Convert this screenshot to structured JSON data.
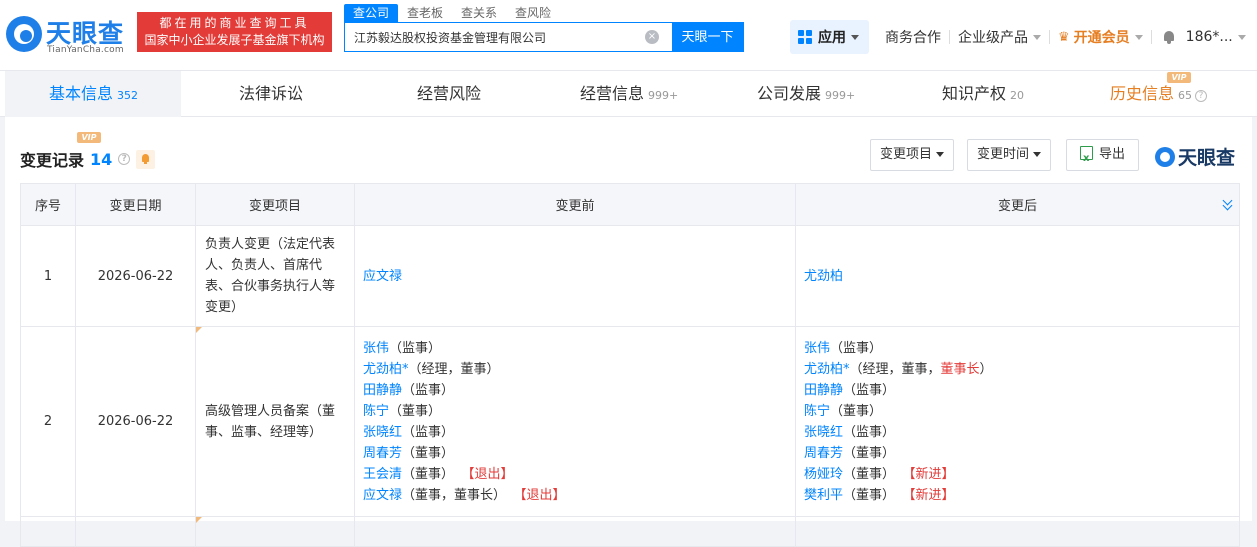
{
  "logo": {
    "cn": "天眼查",
    "en": "TianYanCha.com"
  },
  "slogan": {
    "line1": "都在用的商业查询工具",
    "line2": "国家中小企业发展子基金旗下机构"
  },
  "search": {
    "tabs": [
      "查公司",
      "查老板",
      "查关系",
      "查风险"
    ],
    "value": "江苏毅达股权投资基金管理有限公司",
    "button": "天眼一下"
  },
  "nav": {
    "apps": "应用",
    "business": "商务合作",
    "enterprise": "企业级产品",
    "vip": "开通会员",
    "user": "186*..."
  },
  "tabs": [
    {
      "label": "基本信息",
      "count": "352"
    },
    {
      "label": "法律诉讼",
      "count": ""
    },
    {
      "label": "经营风险",
      "count": ""
    },
    {
      "label": "经营信息",
      "count": "999+"
    },
    {
      "label": "公司发展",
      "count": "999+"
    },
    {
      "label": "知识产权",
      "count": "20"
    },
    {
      "label": "历史信息",
      "count": "65"
    }
  ],
  "vip_badge": "VIP",
  "section": {
    "title": "变更记录",
    "count": "14",
    "filter_item": "变更项目",
    "filter_time": "变更时间",
    "export": "导出",
    "brand": "天眼查"
  },
  "table": {
    "headers": [
      "序号",
      "变更日期",
      "变更项目",
      "变更前",
      "变更后"
    ],
    "rows": [
      {
        "index": "1",
        "date": "2026-06-22",
        "item": "负责人变更（法定代表人、负责人、首席代表、合伙事务执行人等变更）",
        "before": [
          {
            "name": "应文禄",
            "role": "",
            "tag": ""
          }
        ],
        "after": [
          {
            "name": "尤劲柏",
            "role": "",
            "tag": ""
          }
        ]
      },
      {
        "index": "2",
        "date": "2026-06-22",
        "item": "高级管理人员备案（董事、监事、经理等）",
        "before": [
          {
            "name": "张伟",
            "role": "（监事）",
            "tag": ""
          },
          {
            "name": "尤劲柏*",
            "role": "（经理，董事）",
            "tag": ""
          },
          {
            "name": "田静静",
            "role": "（监事）",
            "tag": ""
          },
          {
            "name": "陈宁",
            "role": "（董事）",
            "tag": ""
          },
          {
            "name": "张晓红",
            "role": "（监事）",
            "tag": ""
          },
          {
            "name": "周春芳",
            "role": "（董事）",
            "tag": ""
          },
          {
            "name": "王会清",
            "role": "（董事）",
            "tag": "【退出】"
          },
          {
            "name": "应文禄",
            "role": "（董事，董事长）",
            "tag": "【退出】"
          }
        ],
        "after": [
          {
            "name": "张伟",
            "role": "（监事）",
            "tag": ""
          },
          {
            "name": "尤劲柏*",
            "role": "（经理，董事，",
            "role_red": "董事长",
            "role_end": "）",
            "tag": ""
          },
          {
            "name": "田静静",
            "role": "（监事）",
            "tag": ""
          },
          {
            "name": "陈宁",
            "role": "（董事）",
            "tag": ""
          },
          {
            "name": "张晓红",
            "role": "（监事）",
            "tag": ""
          },
          {
            "name": "周春芳",
            "role": "（董事）",
            "tag": ""
          },
          {
            "name": "杨娅玲",
            "role": "（董事）",
            "tag": "【新进】"
          },
          {
            "name": "樊利平",
            "role": "（董事）",
            "tag": "【新进】"
          }
        ]
      }
    ]
  }
}
